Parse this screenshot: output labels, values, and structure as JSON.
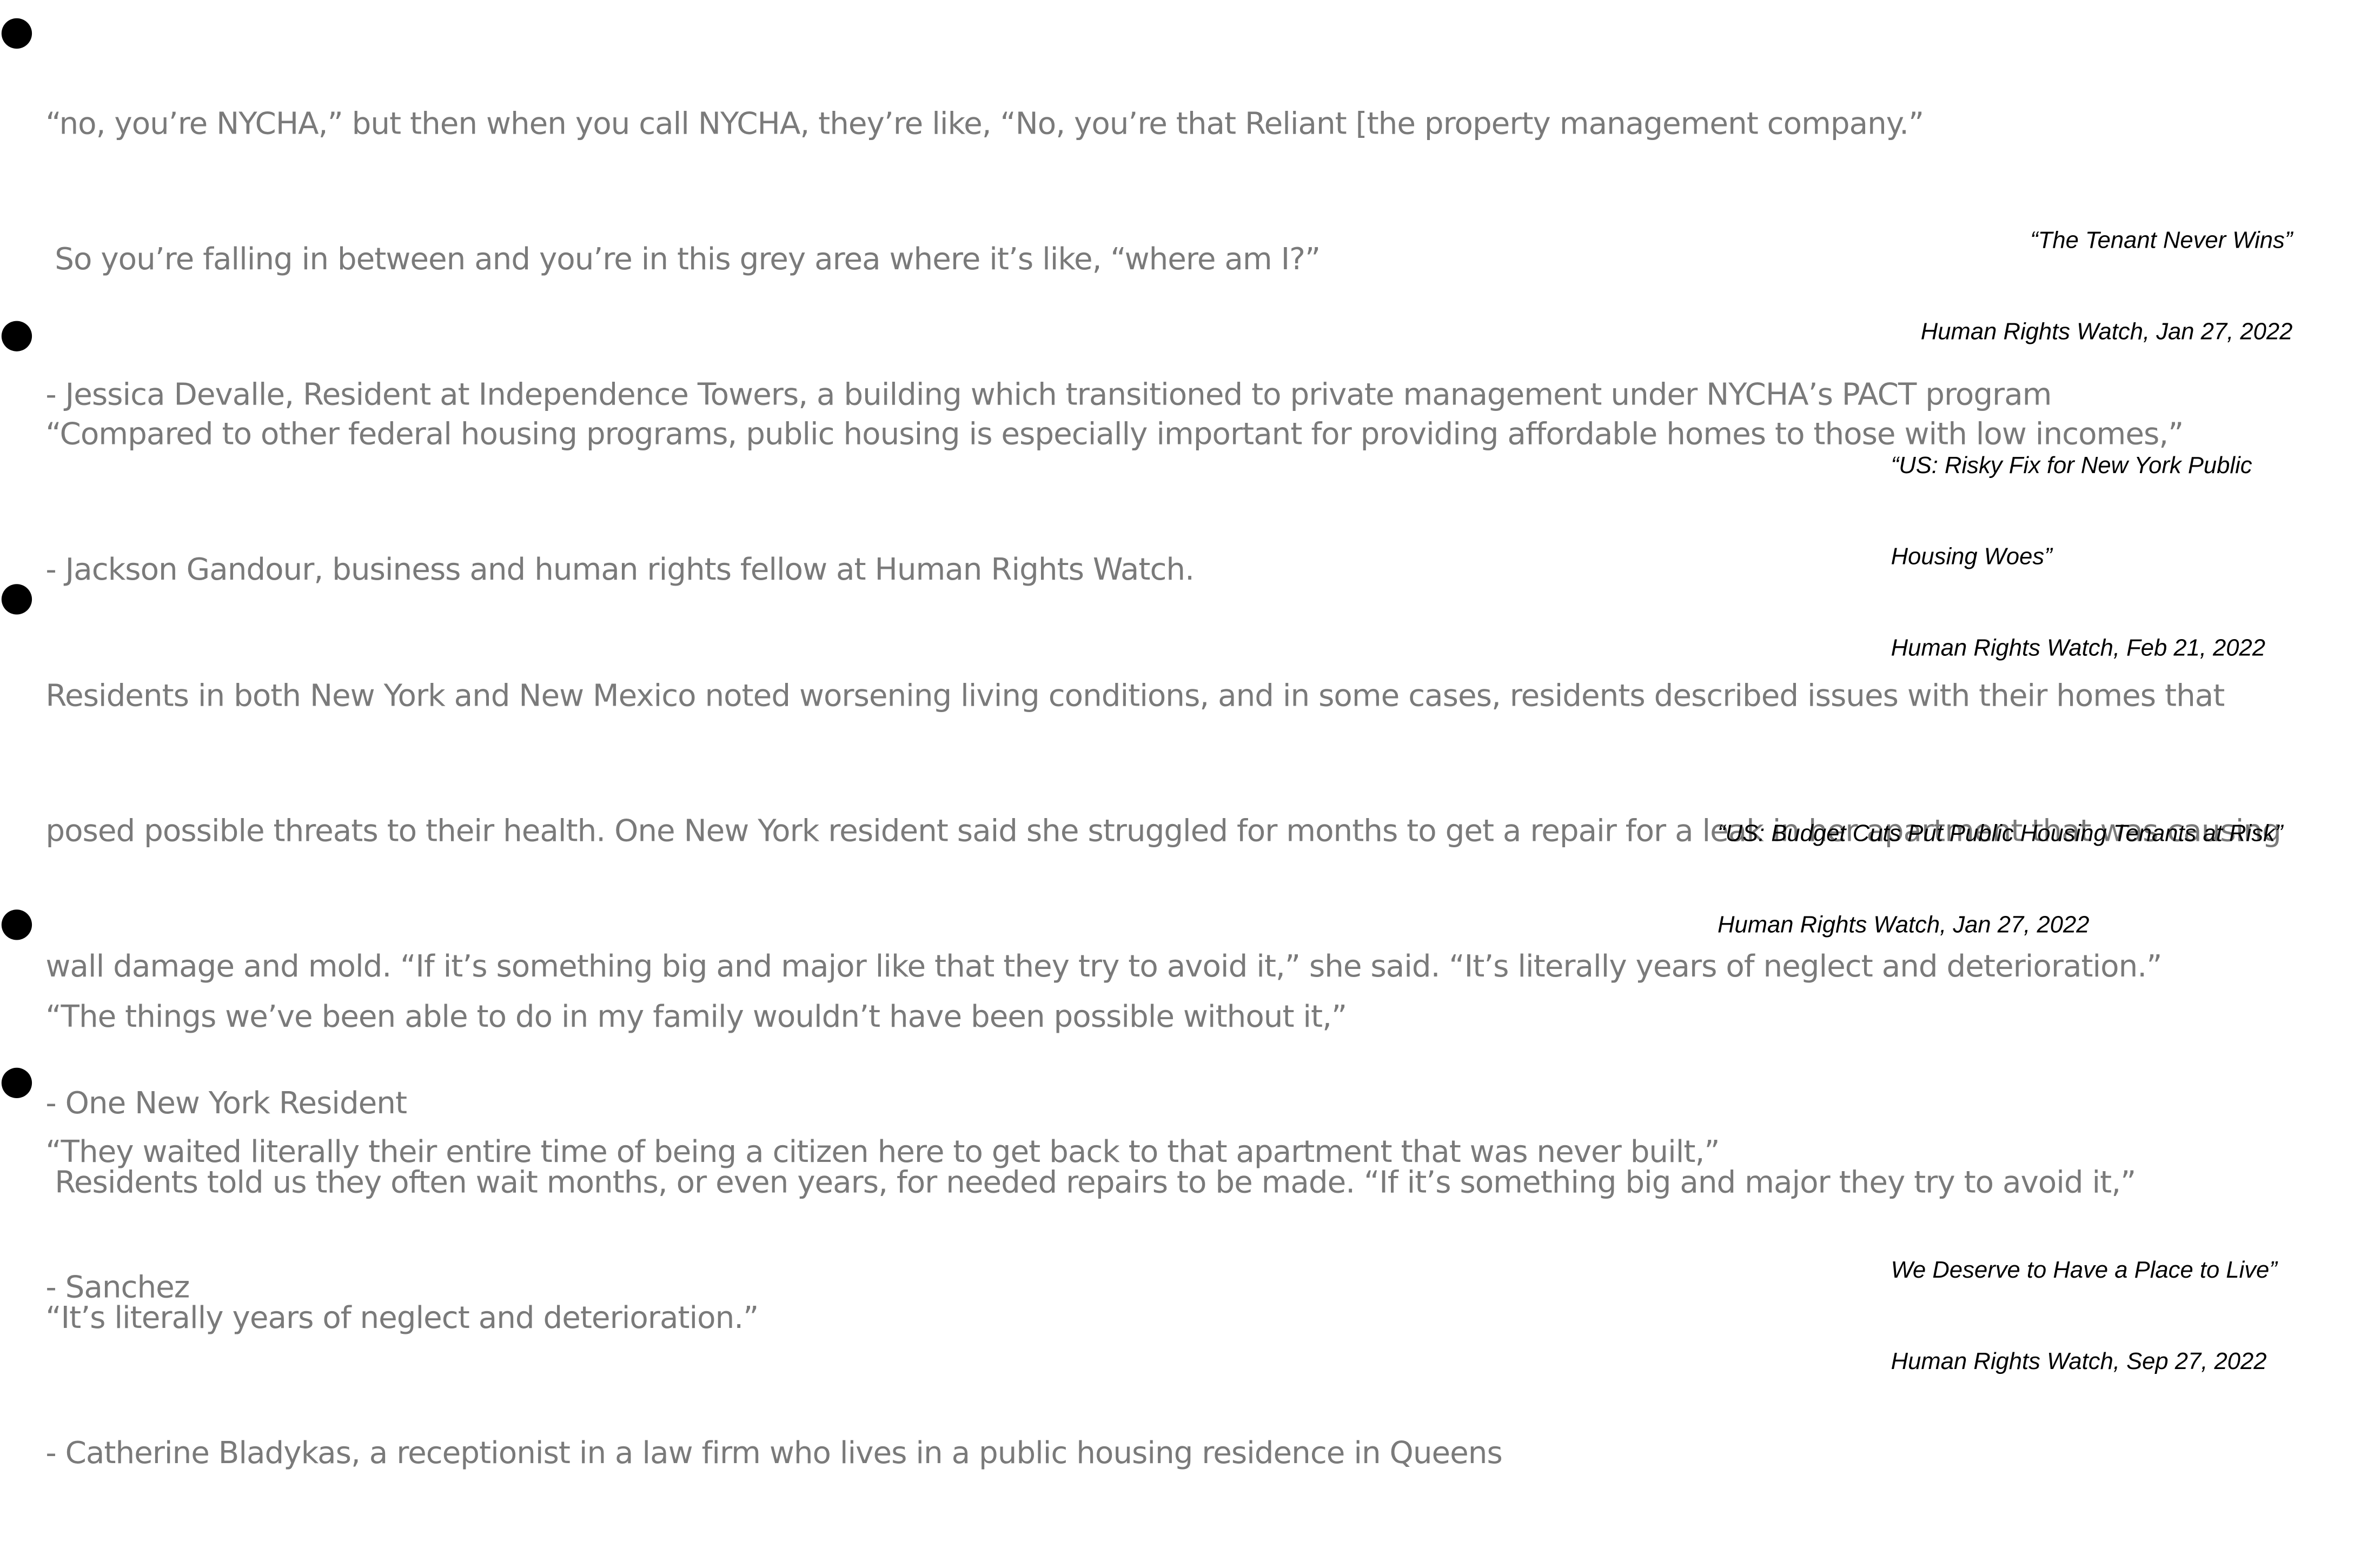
{
  "quotes": [
    {
      "lines": [
        "“no, you’re NYCHA,” but then when you call NYCHA, they’re like, “No, you’re that Reliant [the property management company.”",
        " So you’re falling in between and you’re in this grey area where it’s like, “where am I?”",
        "- Jessica Devalle, Resident at Independence Towers, a building which transitioned to private management under NYCHA’s PACT program"
      ],
      "citation": [
        "“The Tenant Never Wins”",
        "Human Rights Watch, Jan 27, 2022"
      ]
    },
    {
      "lines": [
        "“Compared to other federal housing programs, public housing is especially important for providing affordable homes to those with low incomes,”",
        "- Jackson Gandour, business and human rights fellow at Human Rights Watch."
      ],
      "citation": [
        "“US: Risky Fix for New York Public",
        "Housing Woes”",
        "Human Rights Watch, Feb 21, 2022"
      ]
    },
    {
      "lines": [
        "Residents in both New York and New Mexico noted worsening living conditions, and in some cases, residents described issues with their homes that",
        "posed possible threats to their health. One New York resident said she struggled for months to get a repair for a leak in her apartment that was causing",
        "wall damage and mold. “If it’s something big and major like that they try to avoid it,” she said. “It’s literally years of neglect and deterioration.”",
        "- One New York Resident"
      ],
      "citation": [
        "“US: Budget Cuts Put Public Housing Tenants at Risk”",
        "Human Rights Watch, Jan 27, 2022"
      ]
    },
    {
      "lines": [
        "“The things we’ve been able to do in my family wouldn’t have been possible without it,”",
        "“They waited literally their entire time of being a citizen here to get back to that apartment that was never built,”",
        "- Sanchez"
      ],
      "citation": []
    },
    {
      "lines": [
        " Residents told us they often wait months, or even years, for needed repairs to be made. “If it’s something big and major they try to avoid it,”",
        "“It’s literally years of neglect and deterioration.”",
        "- Catherine Bladykas, a receptionist in a law firm who lives in a public housing residence in Queens"
      ],
      "citation": [
        "We Deserve to Have a Place to Live”",
        "Human Rights Watch, Sep 27, 2022"
      ]
    }
  ]
}
